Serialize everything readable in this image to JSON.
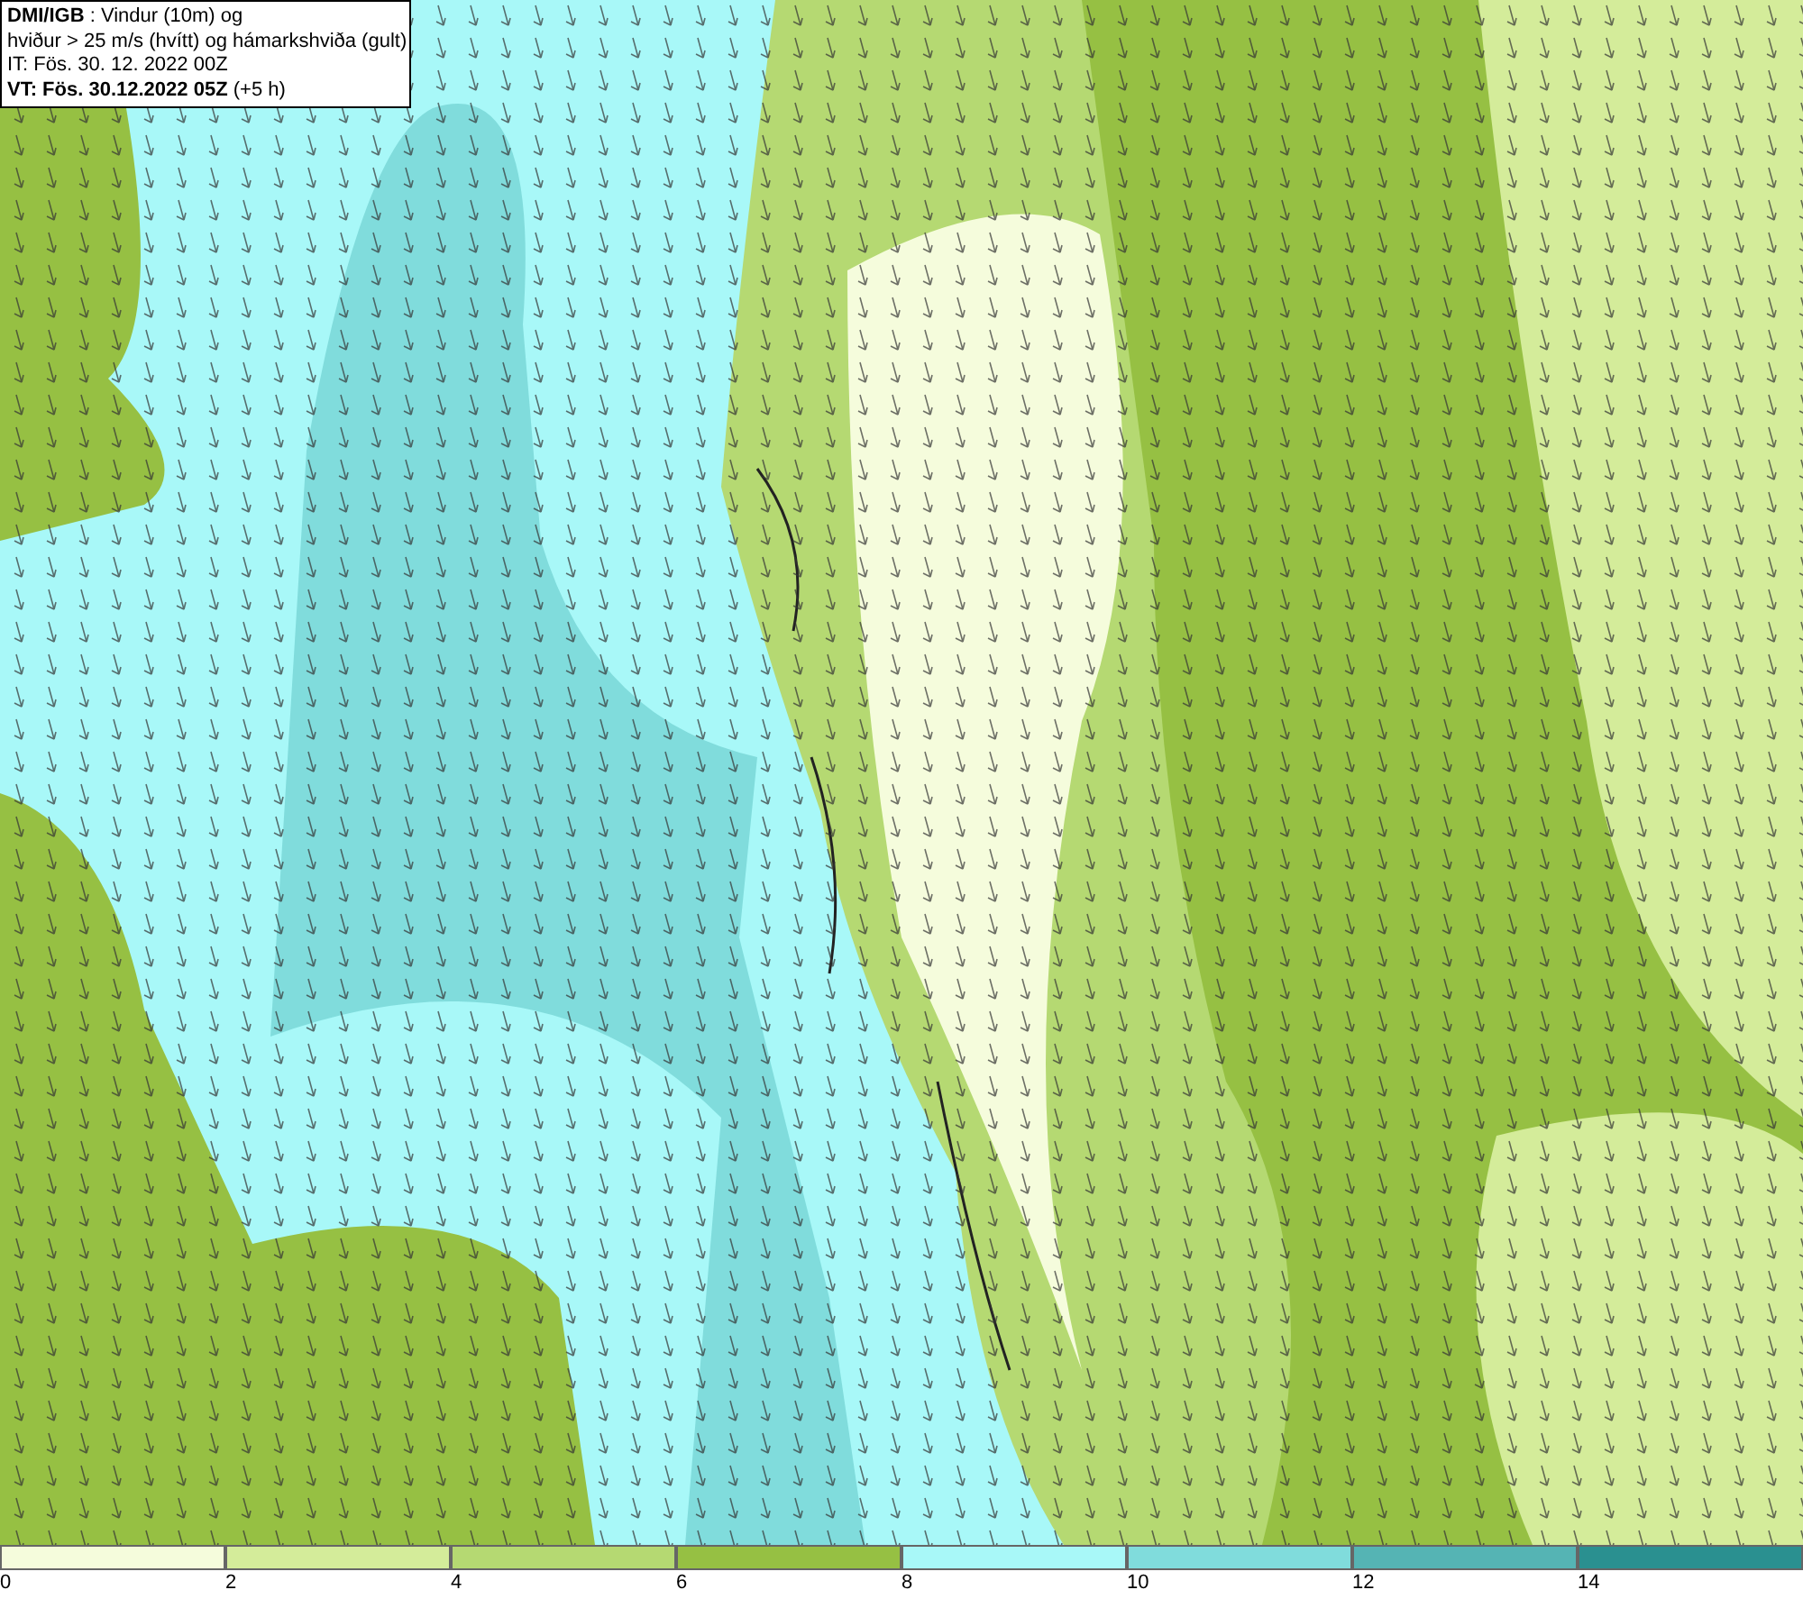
{
  "header": {
    "lines": [
      "**DMI/IGB** : Vindur (10m) og",
      "hviður > 25 m/s (hvítt) og hámarkshviða (gult)",
      "IT: Fös. 30. 12. 2022 00Z",
      "**VT: Fös. 30.12.2022 05Z** (+5 h)"
    ]
  },
  "legend": [
    {
      "label": "0",
      "color": "#f5fcdc"
    },
    {
      "label": "2",
      "color": "#d4ec9a"
    },
    {
      "label": "4",
      "color": "#b5d972"
    },
    {
      "label": "6",
      "color": "#96c043"
    },
    {
      "label": "8",
      "color": "#a8f8f8"
    },
    {
      "label": "10",
      "color": "#80dcdc"
    },
    {
      "label": "12",
      "color": "#55b4b4"
    },
    {
      "label": "14",
      "color": "#2a9090"
    }
  ]
}
